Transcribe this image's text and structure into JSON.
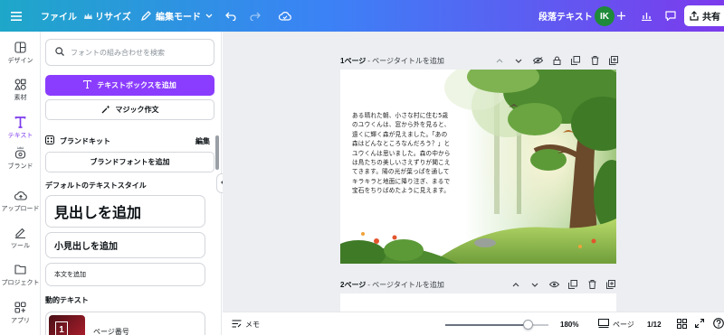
{
  "colors": {
    "accent": "#8b3dff",
    "avatar": "#1f8a3a"
  },
  "topbar": {
    "menu_icon": "hamburger-icon",
    "file_label": "ファイル",
    "resize_label": "リサイズ",
    "edit_mode_label": "編集モード",
    "paragraph_text_label": "段落テキスト",
    "avatar_initials": "IK",
    "share_label": "共有"
  },
  "rail": {
    "items": [
      {
        "label": "デザイン",
        "icon": "design-icon"
      },
      {
        "label": "素材",
        "icon": "elements-icon"
      },
      {
        "label": "テキスト",
        "icon": "text-icon",
        "active": true
      },
      {
        "label": "ブランド",
        "icon": "brand-icon"
      },
      {
        "label": "アップロード",
        "icon": "upload-icon"
      },
      {
        "label": "ツール",
        "icon": "draw-icon"
      },
      {
        "label": "プロジェクト",
        "icon": "folder-icon"
      },
      {
        "label": "アプリ",
        "icon": "apps-icon"
      }
    ]
  },
  "panel": {
    "search_placeholder": "フォントの組み合わせを検索",
    "add_textbox_label": "テキストボックスを追加",
    "magic_write_label": "マジック作文",
    "brand_kit_label": "ブランドキット",
    "brand_kit_edit": "編集",
    "brand_font_label": "ブランドフォントを追加",
    "default_styles_title": "デフォルトのテキストスタイル",
    "heading_label": "見出しを追加",
    "subheading_label": "小見出しを追加",
    "body_label": "本文を追加",
    "dynamic_text_title": "動的テキスト",
    "dynamic_item_label": "ページ番号",
    "dynamic_item_number": "1"
  },
  "canvas": {
    "page1_label": "1ページ",
    "page1_title_placeholder": "- ページタイトルを追加",
    "page2_label": "2ページ",
    "page2_title_placeholder": "- ページタイトルを追加",
    "story_text": "ある晴れた朝、小さな村に住む5歳\nのユウくんは、窓から外を見ると、\n遠くに輝く森が見えました。「あの\n森はどんなところなんだろう？」と\nユウくんは思いました。森の中から\nは鳥たちの美しいさえずりが聞こえ\nてきます。陽の光が葉っぱを通して\nキラキラと地面に降り注ぎ、まるで\n宝石をちりばめたように見えます。"
  },
  "bottombar": {
    "notes_label": "メモ",
    "zoom_percent": 0.8,
    "zoom_value": "180%",
    "pages_label": "ページ",
    "page_counter": "1/12"
  }
}
